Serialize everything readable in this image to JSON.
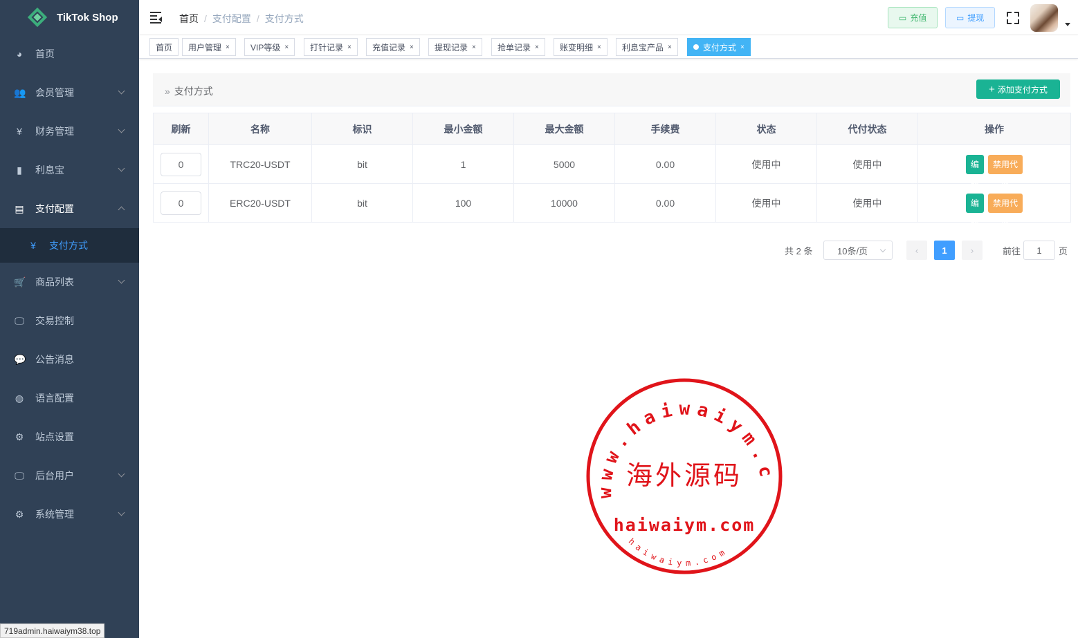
{
  "brand": {
    "name": "TikTok Shop"
  },
  "sidebar": {
    "items": [
      {
        "label": "首页",
        "icon": "dashboard-icon",
        "glyph": "◕"
      },
      {
        "label": "会员管理",
        "icon": "users-icon",
        "glyph": "👥"
      },
      {
        "label": "财务管理",
        "icon": "yen-icon",
        "glyph": "¥"
      },
      {
        "label": "利息宝",
        "icon": "bar-chart-icon",
        "glyph": "▮"
      },
      {
        "label": "支付配置",
        "icon": "payment-config-icon",
        "glyph": "▤"
      },
      {
        "label": "商品列表",
        "icon": "cart-icon",
        "glyph": "🛒"
      },
      {
        "label": "交易控制",
        "icon": "monitor-icon",
        "glyph": "🖵"
      },
      {
        "label": "公告消息",
        "icon": "message-icon",
        "glyph": "💬"
      },
      {
        "label": "语言配置",
        "icon": "globe-icon",
        "glyph": "◍"
      },
      {
        "label": "站点设置",
        "icon": "gear-icon",
        "glyph": "⚙"
      },
      {
        "label": "后台用户",
        "icon": "admin-icon",
        "glyph": "🖵"
      },
      {
        "label": "系统管理",
        "icon": "settings-icon",
        "glyph": "⚙"
      }
    ],
    "subitem": {
      "label": "支付方式",
      "glyph": "¥"
    }
  },
  "status_url": "719admin.haiwaiym38.top",
  "breadcrumb": {
    "home": "首页",
    "level1": "支付配置",
    "level2": "支付方式"
  },
  "header": {
    "recharge": "充值",
    "withdraw": "提现"
  },
  "tags": [
    {
      "label": "首页"
    },
    {
      "label": "用户管理"
    },
    {
      "label": "VIP等级"
    },
    {
      "label": "打针记录"
    },
    {
      "label": "充值记录"
    },
    {
      "label": "提现记录"
    },
    {
      "label": "抢单记录"
    },
    {
      "label": "账变明细"
    },
    {
      "label": "利息宝产品"
    },
    {
      "label": "支付方式"
    }
  ],
  "tag_close": "×",
  "page": {
    "title": "支付方式",
    "add_button": "添加支付方式"
  },
  "table": {
    "headers": [
      "刷新",
      "名称",
      "标识",
      "最小金额",
      "最大金额",
      "手续费",
      "状态",
      "代付状态",
      "操作"
    ],
    "rows": [
      {
        "sort": "0",
        "name": "TRC20-USDT",
        "code": "bit",
        "min": "1",
        "max": "5000",
        "fee": "0.00",
        "status": "使用中",
        "payout_status": "使用中"
      },
      {
        "sort": "0",
        "name": "ERC20-USDT",
        "code": "bit",
        "min": "100",
        "max": "10000",
        "fee": "0.00",
        "status": "使用中",
        "payout_status": "使用中"
      }
    ],
    "actions": {
      "edit": "编辑",
      "disable": "禁用代收"
    }
  },
  "pagination": {
    "total": "共 2 条",
    "page_size": "10条/页",
    "current": "1",
    "goto_label": "前往",
    "goto_value": "1",
    "page_unit": "页"
  },
  "watermark": {
    "ring_text": "www.haiwaiym.com",
    "center": "海外源码",
    "domain": "haiwaiym.com",
    "small": "haiwaiym.com",
    "color": "#e0141a"
  }
}
